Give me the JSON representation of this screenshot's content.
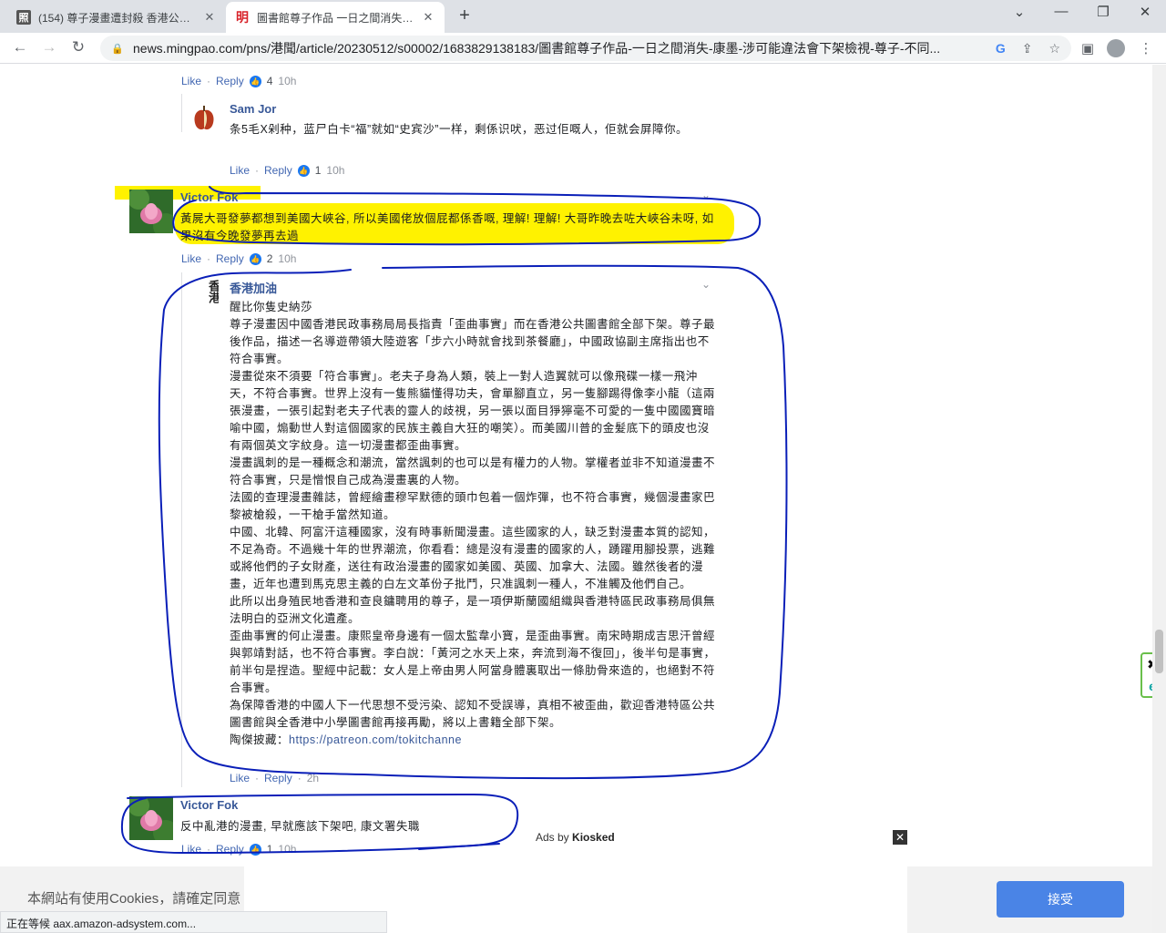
{
  "browser": {
    "tabs": [
      {
        "favicon": "照",
        "title": "(154) 尊子漫畫遭封殺 香港公共圖",
        "close": "✕"
      },
      {
        "favicon": "明",
        "title": "圖書館尊子作品 一日之間消失 康",
        "close": "✕"
      }
    ],
    "new_tab": "+",
    "window_controls": {
      "chevron": "⌄",
      "minimize": "—",
      "restore": "❐",
      "close": "✕"
    },
    "nav": {
      "back": "←",
      "forward": "→",
      "reload": "↻"
    },
    "url": "news.mingpao.com/pns/港聞/article/20230512/s00002/1683829138183/圖書館尊子作品-一日之間消失-康墨-涉可能違法會下架檢視-尊子-不同..."
  },
  "comments": {
    "top_actions": {
      "like": "Like",
      "reply": "Reply",
      "count": "4",
      "time": "10h"
    },
    "sam": {
      "author": "Sam Jor",
      "text": "条5毛X剁种，蓝尸白卡“福”就如“史宾沙”一样，剩係识吠，恶过佢嘅人，佢就会屏障你。",
      "actions": {
        "like": "Like",
        "reply": "Reply",
        "count": "1",
        "time": "10h"
      }
    },
    "victor1": {
      "author": "Victor Fok",
      "text": "黃屍大哥發夢都想到美國大峽谷, 所以美國佬放個屁都係香嘅, 理解! 理解! 大哥昨晚去咗大峽谷未呀, 如果沒有今晚發夢再去過",
      "actions": {
        "like": "Like",
        "reply": "Reply",
        "count": "2",
        "time": "10h"
      }
    },
    "hk": {
      "author": "香港加油",
      "avatar_text": "香港",
      "paragraphs": [
        "醒比你隻史納莎",
        "尊子漫畫因中國香港民政事務局局長指責「歪曲事實」而在香港公共圖書館全部下架。尊子最後作品，描述一名導遊帶領大陸遊客「步六小時就會找到茶餐廳」，中國政協副主席指出也不符合事實。",
        "漫畫從來不須要「符合事實」。老夫子身為人類，裝上一對人造翼就可以像飛碟一樣一飛沖天，不符合事實。世界上沒有一隻熊貓懂得功夫，會單腳直立，另一隻腳踢得像李小龍（這兩張漫畫，一張引起對老夫子代表的靈人的歧視，另一張以面目猙獰毫不可愛的一隻中國國寶暗喻中國，煽動世人對這個國家的民族主義自大狂的嘲笑）。而美國川普的金髮底下的頭皮也沒有兩個英文字紋身。這一切漫畫都歪曲事實。",
        "漫畫諷刺的是一種概念和潮流，當然諷刺的也可以是有權力的人物。掌權者並非不知道漫畫不符合事實，只是憎恨自己成為漫畫裏的人物。",
        "法國的查理漫畫雜誌，曾經繪畫穆罕默德的頭巾包着一個炸彈，也不符合事實，幾個漫畫家巴黎被槍殺，一干槍手當然知道。",
        "中國、北韓、阿富汗這種國家，沒有時事新聞漫畫。這些國家的人，缺乏對漫畫本質的認知，不足為奇。不過幾十年的世界潮流，你看看：總是沒有漫畫的國家的人，踴躍用腳投票，逃難或將他們的子女財產，送往有政治漫畫的國家如美國、英國、加拿大、法國。雖然後者的漫畫，近年也遭到馬克思主義的白左文革份子批鬥，只准諷刺一種人，不准觸及他們自己。",
        "此所以出身殖民地香港和查良鏞聘用的尊子，是一項伊斯蘭國組織與香港特區民政事務局俱無法明白的亞洲文化遺產。",
        "歪曲事實的何止漫畫。康熙皇帝身邊有一個太監韋小寶，是歪曲事實。南宋時期成吉思汗曾經與郭靖對話，也不符合事實。李白說：「黃河之水天上來，奔流到海不復回」，後半句是事實，前半句是捏造。聖經中記載：女人是上帝由男人阿當身體裏取出一條肋骨來造的，也絕對不符合事實。",
        "為保障香港的中國人下一代思想不受污染、認知不受誤導，真相不被歪曲，歡迎香港特區公共圖書館與全香港中小學圖書館再接再勵，將以上書籍全部下架。"
      ],
      "link_prefix": "陶傑披藏：",
      "link": "https://patreon.com/tokitchanne",
      "actions": {
        "like": "Like",
        "reply": "Reply",
        "time": "2h"
      }
    },
    "victor2": {
      "author": "Victor Fok",
      "text": "反中亂港的漫畫, 早就應該下架吧, 康文署失職",
      "actions": {
        "like": "Like",
        "reply": "Reply",
        "count": "1",
        "time": "10h"
      }
    }
  },
  "ads": {
    "prefix": "Ads by",
    "brand": "Kiosked",
    "close": "✕"
  },
  "cookie": {
    "text": "本網站有使用Cookies，請確定同意",
    "accept": "接受"
  },
  "status_bar": "正在等候 aax.amazon-adsystem.com...",
  "side_widget": {
    "close": "✖",
    "badge": "e"
  },
  "colors": {
    "link": "#385898",
    "highlight": "#fff200",
    "annotation_ink": "#0a1fb8",
    "accept_button": "#4a84e6"
  },
  "icons": {
    "lock": "lock-icon",
    "google": "google-icon",
    "share": "share-icon",
    "star": "star-icon",
    "sidepanel": "sidepanel-icon",
    "profile": "profile-icon",
    "menu": "menu-icon"
  }
}
